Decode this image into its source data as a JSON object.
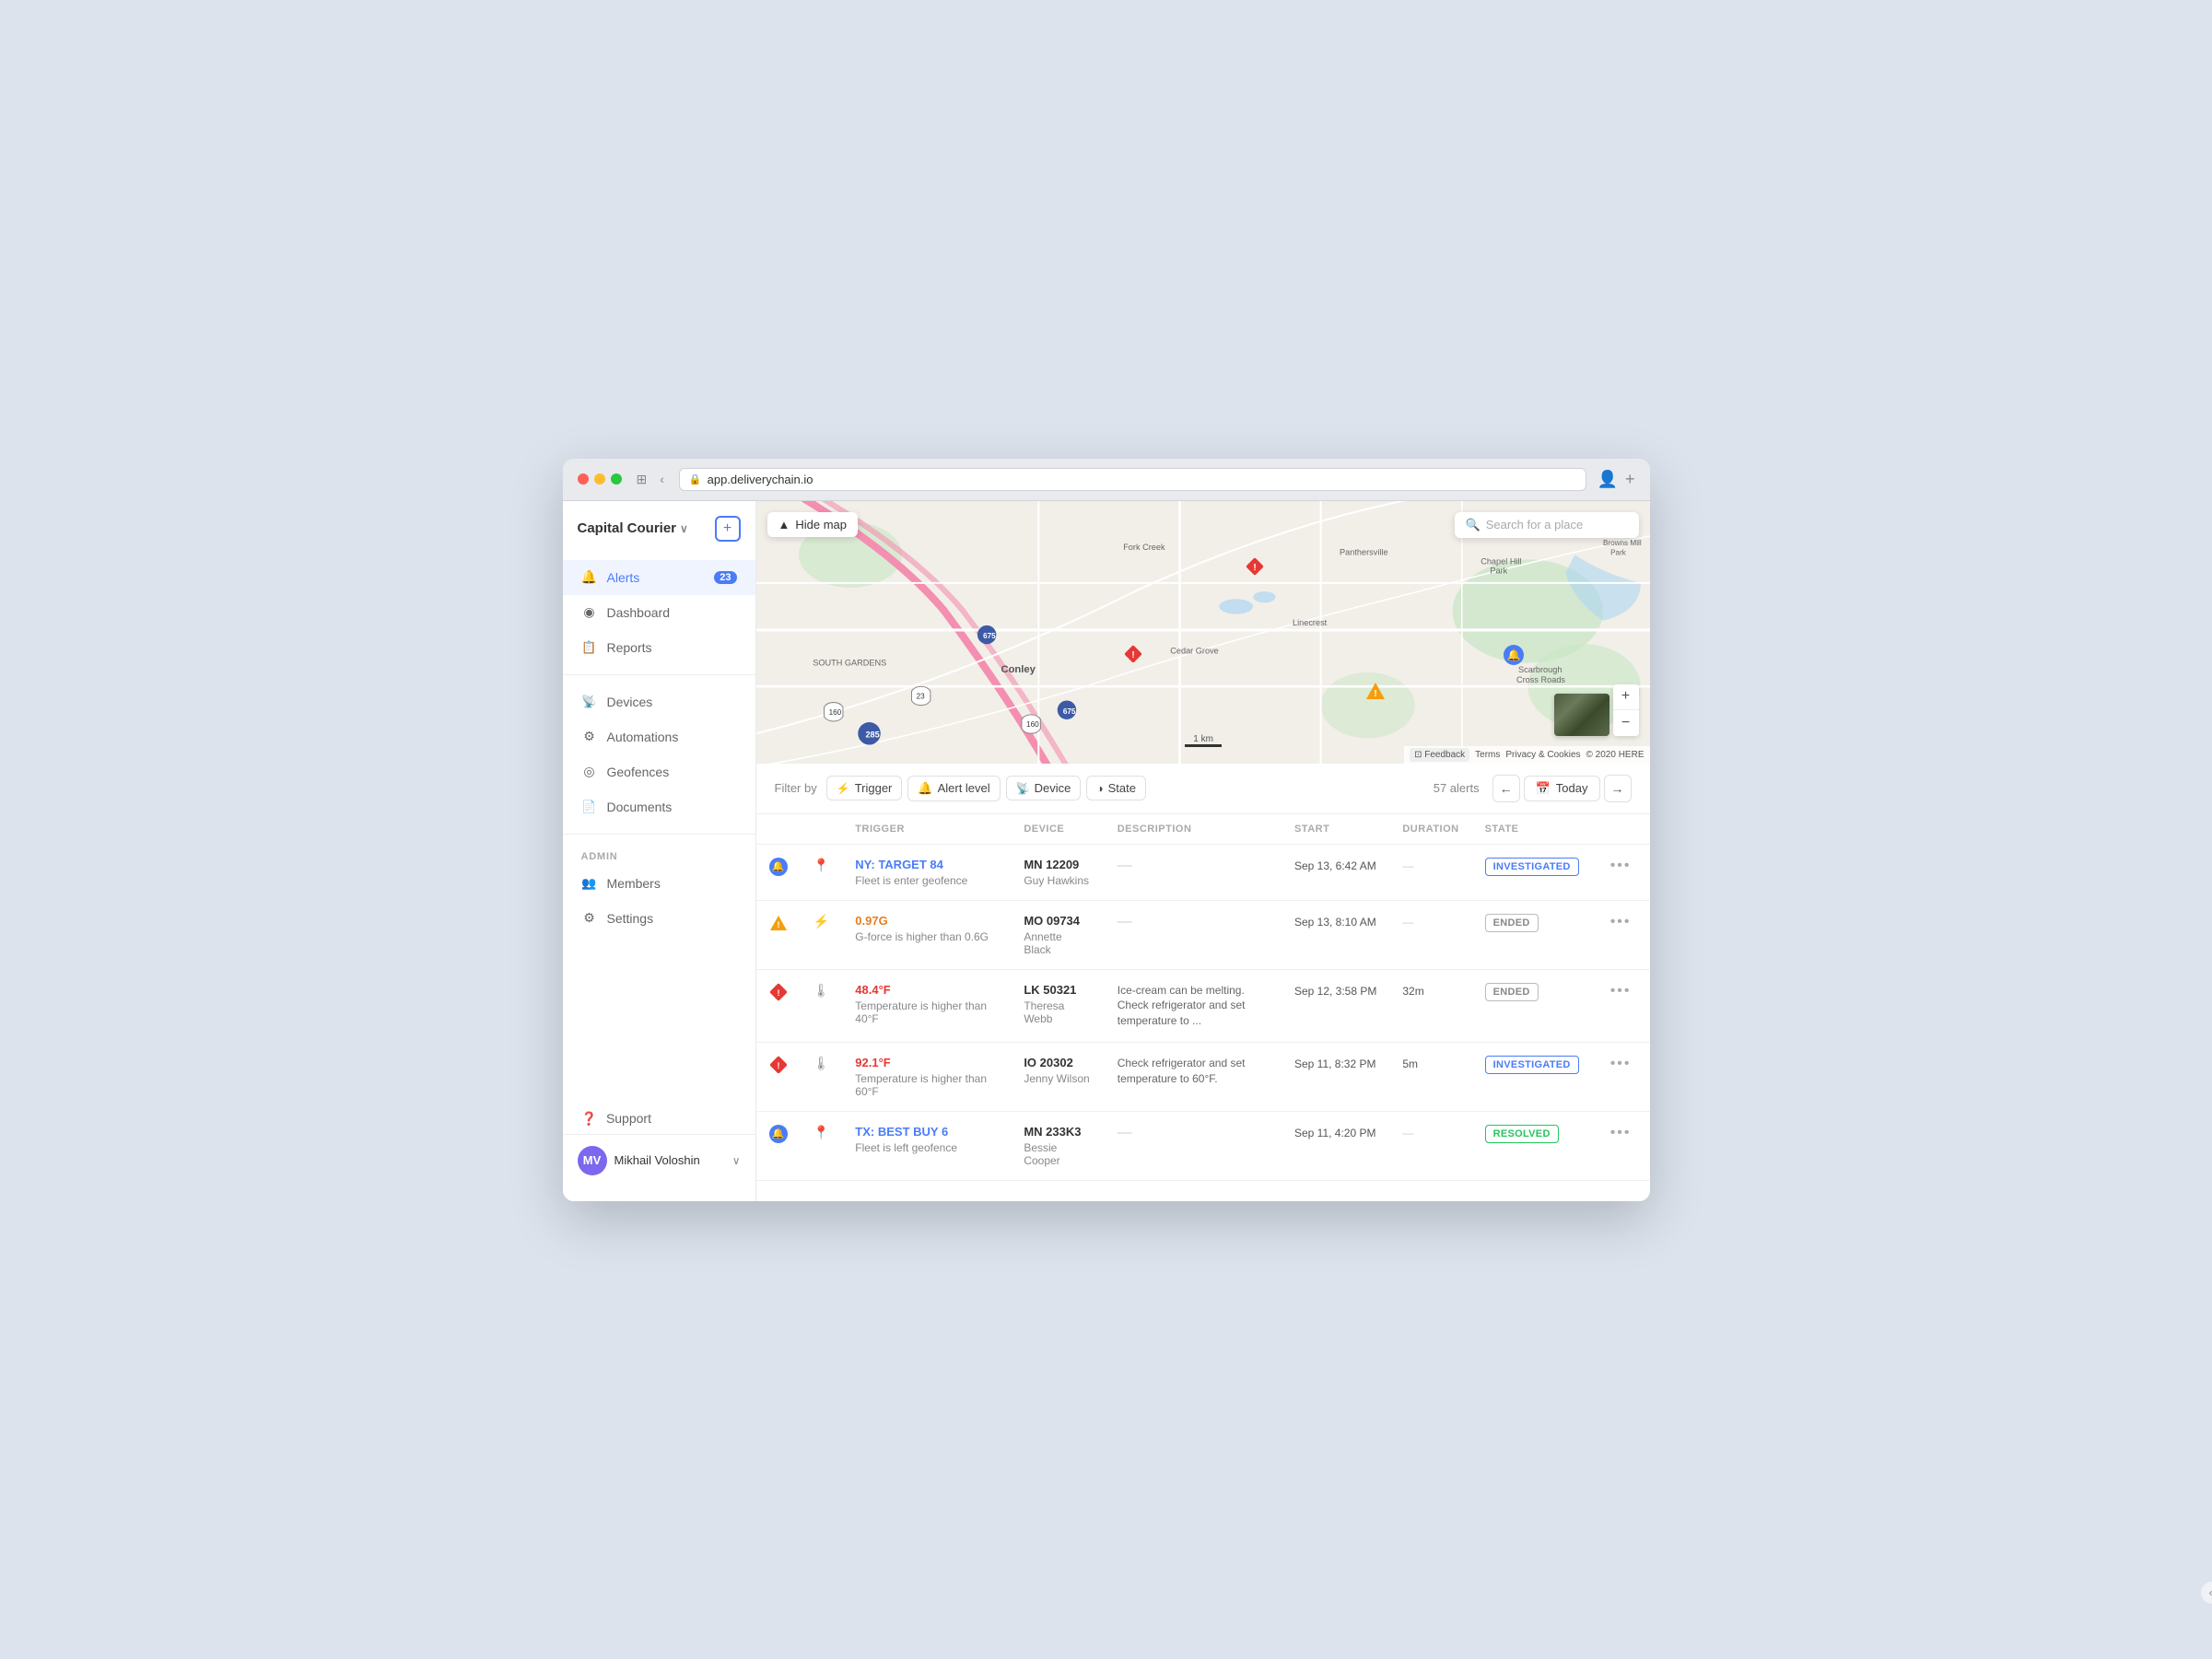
{
  "browser": {
    "url": "app.deliverychain.io",
    "new_tab_label": "+",
    "back_label": "‹",
    "window_icon": "⊞"
  },
  "sidebar": {
    "brand": "Capital Courier",
    "brand_chevron": "∨",
    "add_btn_label": "+",
    "nav_items": [
      {
        "id": "alerts",
        "label": "Alerts",
        "icon": "bell",
        "badge": "23",
        "active": true
      },
      {
        "id": "dashboard",
        "label": "Dashboard",
        "icon": "dashboard",
        "badge": null,
        "active": false
      },
      {
        "id": "reports",
        "label": "Reports",
        "icon": "reports",
        "badge": null,
        "active": false
      }
    ],
    "nav_items2": [
      {
        "id": "devices",
        "label": "Devices",
        "icon": "devices"
      },
      {
        "id": "automations",
        "label": "Automations",
        "icon": "automations"
      },
      {
        "id": "geofences",
        "label": "Geofences",
        "icon": "geofences"
      },
      {
        "id": "documents",
        "label": "Documents",
        "icon": "documents"
      }
    ],
    "admin_label": "ADMIN",
    "admin_items": [
      {
        "id": "members",
        "label": "Members",
        "icon": "members"
      },
      {
        "id": "settings",
        "label": "Settings",
        "icon": "settings"
      }
    ],
    "support_label": "Support",
    "user": {
      "name": "Mikhail Voloshin",
      "initials": "MV",
      "chevron": "∨"
    },
    "collapse_btn": "«"
  },
  "map": {
    "hide_btn": "Hide map",
    "search_placeholder": "Search for a place",
    "search_icon": "🔍",
    "zoom_in": "+",
    "zoom_out": "−",
    "attribution": "Terms  Privacy & Cookies  © 2020 HERE",
    "scale_label": "1 km",
    "feedback_label": "Feedback"
  },
  "filter_bar": {
    "filter_by_label": "Filter by",
    "trigger_label": "Trigger",
    "alert_level_label": "Alert level",
    "device_label": "Device",
    "state_label": "State",
    "alerts_count": "57 alerts",
    "today_label": "Today"
  },
  "table": {
    "headers": [
      "",
      "",
      "TRIGGER",
      "DEVICE",
      "DESCRIPTION",
      "START",
      "DURATION",
      "STATE",
      ""
    ],
    "rows": [
      {
        "icon_type": "bell",
        "type_icon": "geofence",
        "trigger_name": "NY: TARGET 84",
        "trigger_name_color": "blue",
        "trigger_desc": "Fleet is enter geofence",
        "device_id": "MN 12209",
        "device_person": "Guy Hawkins",
        "description": "—",
        "start": "Sep 13, 6:42 AM",
        "duration": "—",
        "state": "INVESTIGATED",
        "state_type": "investigated"
      },
      {
        "icon_type": "warning",
        "type_icon": "lightning",
        "trigger_name": "0.97G",
        "trigger_name_color": "orange",
        "trigger_desc": "G-force is higher than 0.6G",
        "device_id": "MO 09734",
        "device_person": "Annette Black",
        "description": "—",
        "start": "Sep 13, 8:10 AM",
        "duration": "—",
        "state": "ENDED",
        "state_type": "ended"
      },
      {
        "icon_type": "alert",
        "type_icon": "thermometer",
        "trigger_name": "48.4°F",
        "trigger_name_color": "red",
        "trigger_desc": "Temperature is higher than 40°F",
        "device_id": "LK 50321",
        "device_person": "Theresa Webb",
        "description": "Ice-cream can be melting. Check refrigerator and set temperature to ...",
        "start": "Sep 12, 3:58 PM",
        "duration": "32m",
        "state": "ENDED",
        "state_type": "ended"
      },
      {
        "icon_type": "alert",
        "type_icon": "thermometer",
        "trigger_name": "92.1°F",
        "trigger_name_color": "red",
        "trigger_desc": "Temperature is higher than 60°F",
        "device_id": "IO 20302",
        "device_person": "Jenny Wilson",
        "description": "Check refrigerator and set temperature to 60°F.",
        "start": "Sep 11, 8:32 PM",
        "duration": "5m",
        "state": "INVESTIGATED",
        "state_type": "investigated"
      },
      {
        "icon_type": "bell",
        "type_icon": "geofence",
        "trigger_name": "TX: BEST BUY 6",
        "trigger_name_color": "blue",
        "trigger_desc": "Fleet is left geofence",
        "device_id": "MN 233K3",
        "device_person": "Bessie Cooper",
        "description": "—",
        "start": "Sep 11, 4:20 PM",
        "duration": "—",
        "state": "RESOLVED",
        "state_type": "resolved"
      }
    ]
  }
}
